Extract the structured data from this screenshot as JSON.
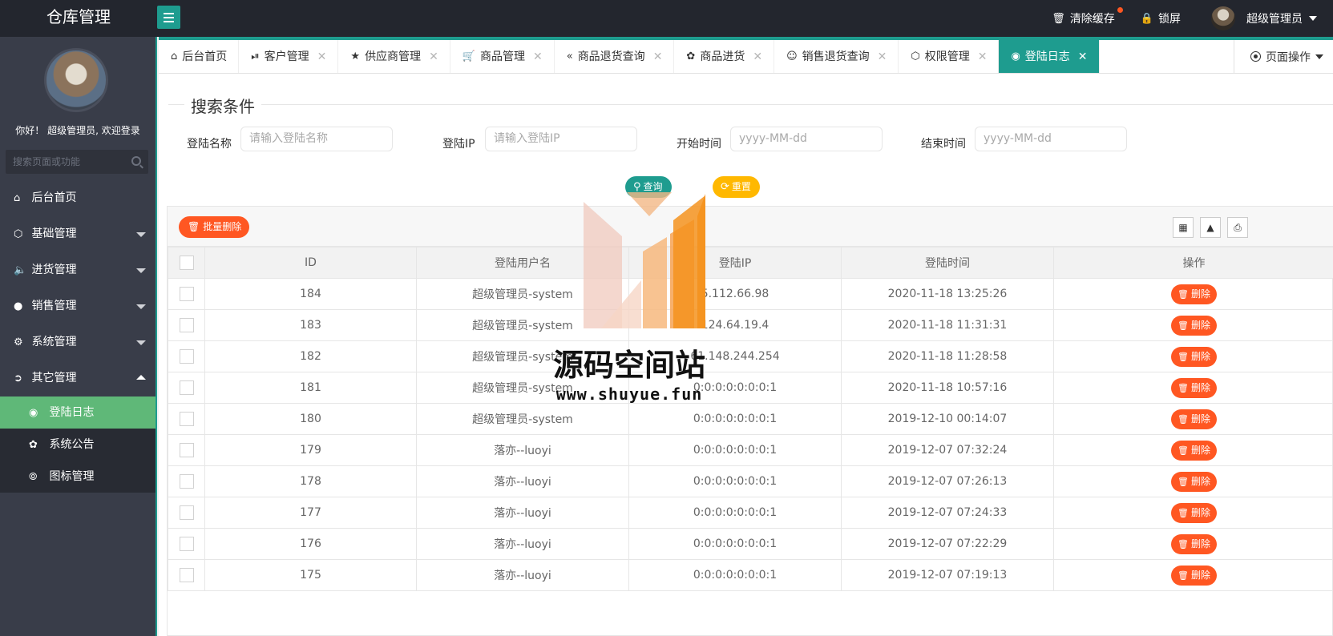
{
  "header": {
    "logo": "仓库管理",
    "clear_cache": "清除缓存",
    "lock_screen": "锁屏",
    "user_name": "超级管理员"
  },
  "sidebar": {
    "welcome": "你好！ 超级管理员, 欢迎登录",
    "search_placeholder": "搜索页面或功能",
    "items": [
      {
        "label": "后台首页",
        "icon": "home-icon"
      },
      {
        "label": "基础管理",
        "icon": "cube-icon"
      },
      {
        "label": "进货管理",
        "icon": "speaker-icon"
      },
      {
        "label": "销售管理",
        "icon": "chat-icon"
      },
      {
        "label": "系统管理",
        "icon": "gear-icon"
      },
      {
        "label": "其它管理",
        "icon": "circle-arrow-icon"
      }
    ],
    "sub_items": [
      {
        "label": "登陆日志",
        "icon": "log-icon"
      },
      {
        "label": "系统公告",
        "icon": "fire-icon"
      },
      {
        "label": "图标管理",
        "icon": "compass-icon"
      }
    ]
  },
  "tabs": [
    {
      "label": "后台首页",
      "icon": "home-icon"
    },
    {
      "label": "客户管理",
      "icon": "pause-circle-icon"
    },
    {
      "label": "供应商管理",
      "icon": "star-icon"
    },
    {
      "label": "商品管理",
      "icon": "cart-icon"
    },
    {
      "label": "商品退货查询",
      "icon": "double-left-icon"
    },
    {
      "label": "商品进货",
      "icon": "fire-icon"
    },
    {
      "label": "销售退货查询",
      "icon": "user-icon"
    },
    {
      "label": "权限管理",
      "icon": "cube-icon"
    },
    {
      "label": "登陆日志",
      "icon": "log-icon"
    }
  ],
  "page_ops": "页面操作",
  "search": {
    "legend": "搜索条件",
    "name_label": "登陆名称",
    "name_placeholder": "请输入登陆名称",
    "ip_label": "登陆IP",
    "ip_placeholder": "请输入登陆IP",
    "start_label": "开始时间",
    "start_placeholder": "yyyy-MM-dd",
    "end_label": "结束时间",
    "end_placeholder": "yyyy-MM-dd",
    "query_btn": "查询",
    "reset_btn": "重置"
  },
  "toolbar": {
    "batch_delete": "批量删除"
  },
  "table": {
    "columns": [
      "ID",
      "登陆用户名",
      "登陆IP",
      "登陆时间",
      "操作"
    ],
    "delete_label": "删除",
    "rows": [
      {
        "id": "184",
        "user": "超级管理员-system",
        "ip": "5.112.66.98",
        "time": "2020-11-18 13:25:26"
      },
      {
        "id": "183",
        "user": "超级管理员-system",
        "ip": "124.64.19.4",
        "time": "2020-11-18 11:31:31"
      },
      {
        "id": "182",
        "user": "超级管理员-system",
        "ip": "61.148.244.254",
        "time": "2020-11-18 11:28:58"
      },
      {
        "id": "181",
        "user": "超级管理员-system",
        "ip": "0:0:0:0:0:0:0:1",
        "time": "2020-11-18 10:57:16"
      },
      {
        "id": "180",
        "user": "超级管理员-system",
        "ip": "0:0:0:0:0:0:0:1",
        "time": "2019-12-10 00:14:07"
      },
      {
        "id": "179",
        "user": "落亦--luoyi",
        "ip": "0:0:0:0:0:0:0:1",
        "time": "2019-12-07 07:32:24"
      },
      {
        "id": "178",
        "user": "落亦--luoyi",
        "ip": "0:0:0:0:0:0:0:1",
        "time": "2019-12-07 07:26:13"
      },
      {
        "id": "177",
        "user": "落亦--luoyi",
        "ip": "0:0:0:0:0:0:0:1",
        "time": "2019-12-07 07:24:33"
      },
      {
        "id": "176",
        "user": "落亦--luoyi",
        "ip": "0:0:0:0:0:0:0:1",
        "time": "2019-12-07 07:22:29"
      },
      {
        "id": "175",
        "user": "落亦--luoyi",
        "ip": "0:0:0:0:0:0:0:1",
        "time": "2019-12-07 07:19:13"
      }
    ]
  },
  "watermark": {
    "title": "源码空间站",
    "url": "www.shuyue.fun"
  },
  "colors": {
    "header_bg": "#23262e",
    "sidebar_bg": "#393d49",
    "accent": "#1e9c8f",
    "active_sub": "#5fb878",
    "danger": "#ff5722",
    "warning": "#ffb800"
  }
}
